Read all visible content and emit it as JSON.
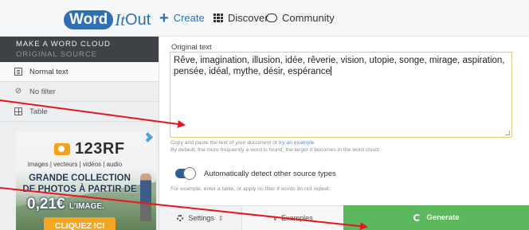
{
  "header": {
    "logo": {
      "word": "Word",
      "it": "It",
      "out": "Out"
    },
    "nav": {
      "create": "Create",
      "discover": "Discover",
      "community": "Community"
    },
    "colors": {
      "brand": "#2f6fb3",
      "generate": "#5cb85c",
      "annotation_red": "#e8141e"
    }
  },
  "sidebar": {
    "title": "MAKE A WORD CLOUD",
    "subtitle": "ORIGINAL SOURCE",
    "items": [
      {
        "label": "Normal text",
        "icon": "document-icon",
        "active": true
      },
      {
        "label": "No filter",
        "icon": "filter-off-icon",
        "active": false
      },
      {
        "label": "Table",
        "icon": "table-icon",
        "active": false
      }
    ]
  },
  "ad": {
    "brand": "123RF",
    "tagline": "images | vecteurs | vidéos | audio",
    "line1": "GRANDE COLLECTION",
    "line2": "DE PHOTOS À PARTIR DE",
    "price": "0,21€",
    "price_suffix": "L'IMAGE.",
    "cta": "CLIQUEZ ICI"
  },
  "editor": {
    "label": "Original text",
    "text": "Rêve, imagination, illusion, idée, rêverie, vision, utopie, songe, mirage, aspiration, pensée, idéal, mythe, désir, espérance",
    "help_prefix": "Copy and paste the text of your document or",
    "help_link": "try an example",
    "help2": "By default, the more frequently a word is found, the larger it becomes in the word cloud.",
    "toggle_label": "Automatically detect other source types",
    "toggle_on": true,
    "help3": "For example, enter a table, or apply no filter if words do not repeat."
  },
  "actions": {
    "settings": "Settings",
    "examples": "Examples",
    "generate": "Generate"
  }
}
